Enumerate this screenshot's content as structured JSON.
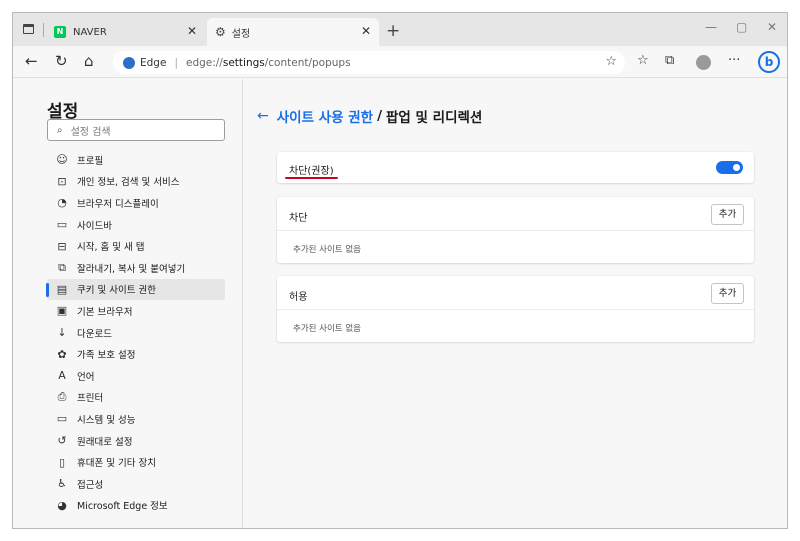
{
  "tabs": [
    {
      "title": "NAVER",
      "favicon": "N"
    },
    {
      "title": "설정"
    }
  ],
  "address_bar": {
    "site_label": "Edge",
    "url_prefix": "edge://",
    "url_bold": "settings",
    "url_rest": "/content/popups"
  },
  "bing_label": "b",
  "sidebar": {
    "title": "설정",
    "search_placeholder": "설정 검색",
    "items": [
      {
        "label": "프로필",
        "icon": "profile-icon",
        "glyph": "☺"
      },
      {
        "label": "개인 정보, 검색 및 서비스",
        "icon": "lock-icon",
        "glyph": "⊡"
      },
      {
        "label": "브라우저 디스플레이",
        "icon": "appearance-icon",
        "glyph": "◔"
      },
      {
        "label": "사이드바",
        "icon": "sidebar-icon",
        "glyph": "▭"
      },
      {
        "label": "시작, 홈 및 새 탭",
        "icon": "home-tab-icon",
        "glyph": "⊟"
      },
      {
        "label": "잘라내기, 복사 및 붙여넣기",
        "icon": "share-icon",
        "glyph": "⧉"
      },
      {
        "label": "쿠키 및 사이트 권한",
        "icon": "cookies-icon",
        "glyph": "▤",
        "selected": true
      },
      {
        "label": "기본 브라우저",
        "icon": "default-browser-icon",
        "glyph": "▣"
      },
      {
        "label": "다운로드",
        "icon": "download-icon",
        "glyph": "↓"
      },
      {
        "label": "가족 보호 설정",
        "icon": "family-icon",
        "glyph": "✿"
      },
      {
        "label": "언어",
        "icon": "language-icon",
        "glyph": "A"
      },
      {
        "label": "프린터",
        "icon": "printer-icon",
        "glyph": "⎙"
      },
      {
        "label": "시스템 및 성능",
        "icon": "system-icon",
        "glyph": "▭"
      },
      {
        "label": "원래대로 설정",
        "icon": "reset-icon",
        "glyph": "↺"
      },
      {
        "label": "휴대폰 및 기타 장치",
        "icon": "phone-icon",
        "glyph": "▯"
      },
      {
        "label": "접근성",
        "icon": "accessibility-icon",
        "glyph": "♿"
      },
      {
        "label": "Microsoft Edge 정보",
        "icon": "edge-logo-icon",
        "glyph": "◕"
      }
    ]
  },
  "main": {
    "breadcrumb": "사이트 사용 권한",
    "separator": "/",
    "page_title": "팝업 및 리디렉션",
    "toggle_label": "차단(권장)",
    "toggle_on": true,
    "block_section": {
      "title": "차단",
      "add_label": "추가",
      "empty_text": "추가된 사이트 없음"
    },
    "allow_section": {
      "title": "허용",
      "add_label": "추가",
      "empty_text": "추가된 사이트 없음"
    }
  },
  "colors": {
    "accent": "#1a6fe8",
    "underline": "#d0021b",
    "naver_green": "#03c75a"
  }
}
